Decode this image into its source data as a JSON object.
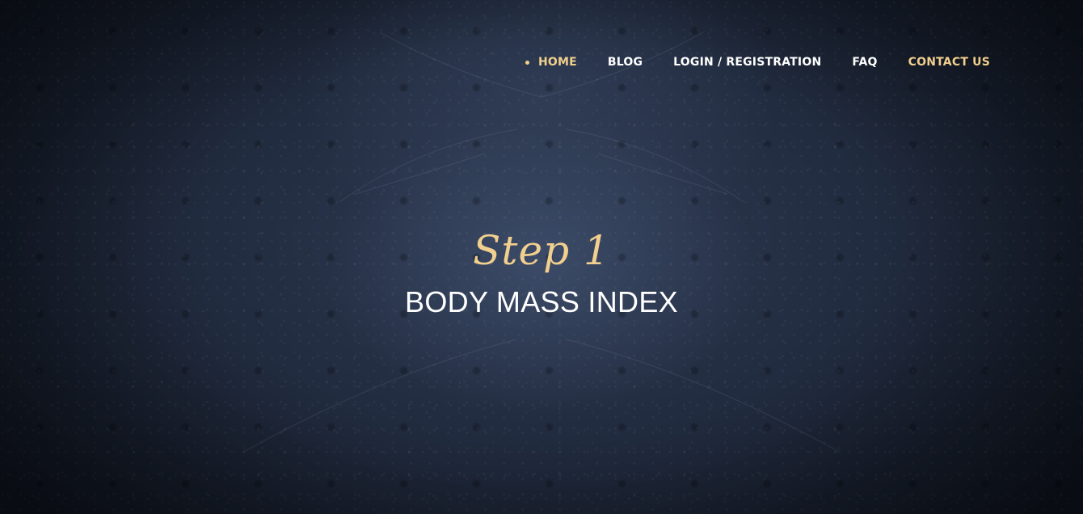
{
  "nav": {
    "items": [
      {
        "label": "HOME",
        "state": "active"
      },
      {
        "label": "BLOG",
        "state": "normal"
      },
      {
        "label": "LOGIN / REGISTRATION",
        "state": "normal"
      },
      {
        "label": "FAQ",
        "state": "normal"
      },
      {
        "label": "CONTACT US",
        "state": "accent"
      }
    ]
  },
  "hero": {
    "step_label": "Step 1",
    "title": "BODY MASS INDEX"
  },
  "colors": {
    "accent": "#f1cf8e",
    "text": "#ffffff",
    "background": "#1c2434"
  }
}
